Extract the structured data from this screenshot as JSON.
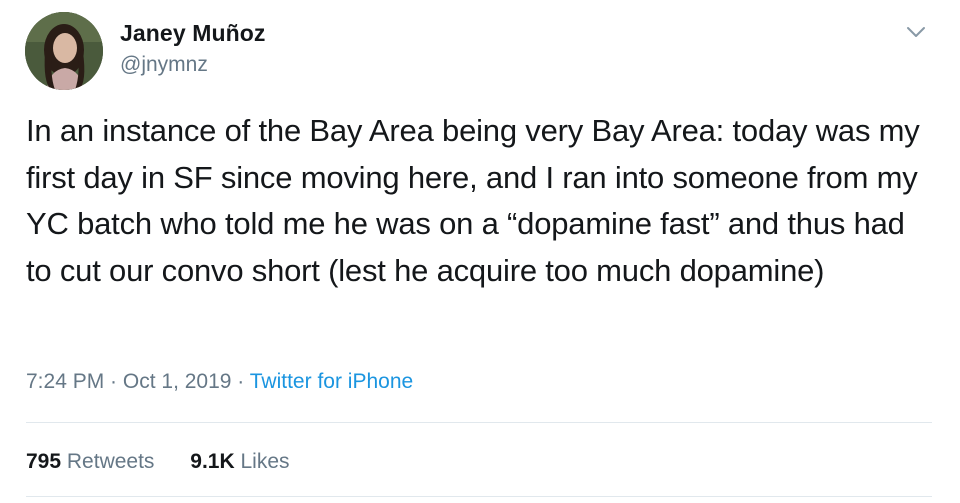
{
  "tweet": {
    "author": {
      "name": "Janey Muñoz",
      "handle": "@jnymnz",
      "avatar_icon": "profile-photo"
    },
    "menu_icon": "chevron-down-icon",
    "text": "In an instance of the Bay Area being very Bay Area: today was my first day in SF since moving here, and I ran into someone from my YC batch who told me he was on a “dopamine fast” and thus had to cut our convo short (lest he acquire too much dopamine)",
    "time": "7:24 PM",
    "separator": " · ",
    "date": "Oct 1, 2019",
    "source": "Twitter for iPhone",
    "stats": {
      "retweets_count": "795",
      "retweets_label": "Retweets",
      "likes_count": "9.1K",
      "likes_label": "Likes"
    }
  },
  "colors": {
    "text_primary": "#14171a",
    "text_secondary": "#657786",
    "link": "#1b95e0",
    "divider": "#e1e8ed"
  }
}
